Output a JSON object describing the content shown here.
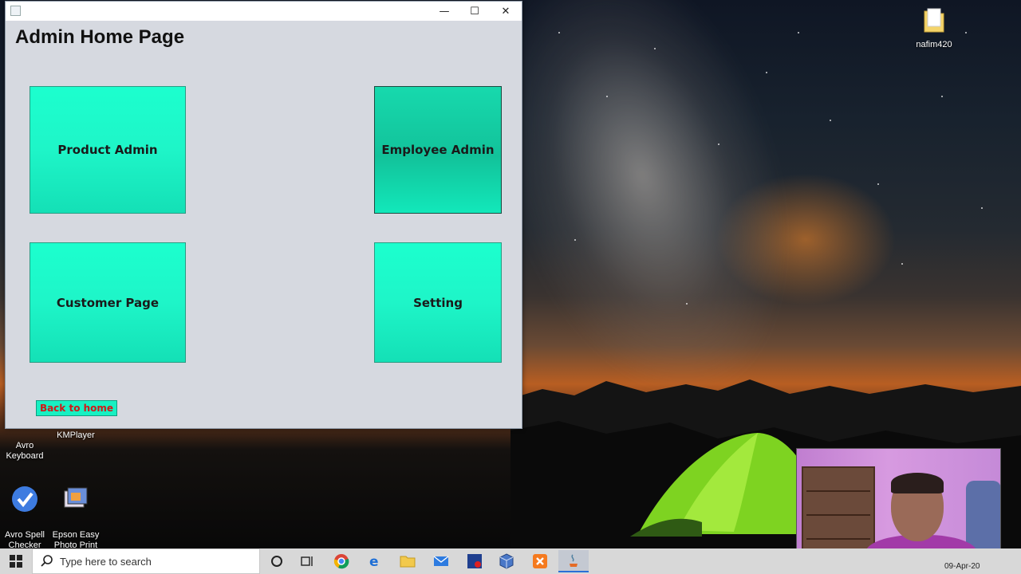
{
  "window": {
    "title": "",
    "minimize_glyph": "—",
    "maximize_glyph": "☐",
    "close_glyph": "✕",
    "page_title": "Admin Home Page"
  },
  "tiles": {
    "product_admin": "Product Admin",
    "employee_admin": "Employee Admin",
    "customer_page": "Customer Page",
    "setting": "Setting"
  },
  "back_button": "Back to home",
  "desktop_icons": {
    "folder": "nafim420",
    "avro_keyboard": "Avro\nKeyboard",
    "kmplayer": "KMPlayer",
    "avro_spell": "Avro Spell\nChecker",
    "epson": "Epson Easy\nPhoto Print"
  },
  "taskbar": {
    "search_placeholder": "Type here to search",
    "date": "09-Apr-20",
    "pinned_icons": [
      "cortana-icon",
      "task-view-icon",
      "chrome-icon",
      "edge-icon",
      "file-explorer-icon",
      "mail-icon",
      "app-icon",
      "box-icon",
      "xampp-icon",
      "java-icon"
    ]
  },
  "colors": {
    "tile_fill": "#1ef5c8",
    "back_button_text": "#d11818",
    "window_bg": "#d6d9e0"
  }
}
